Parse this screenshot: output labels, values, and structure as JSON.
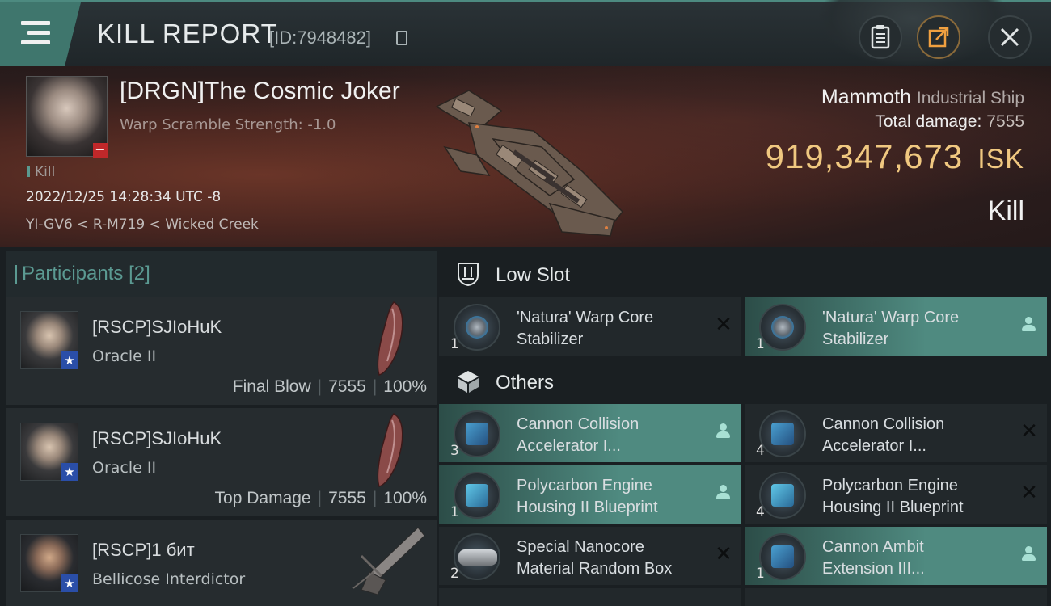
{
  "header": {
    "title": "KILL REPORT",
    "report_id": "[ID:7948482]",
    "buttons": [
      "clipboard-icon",
      "share-icon",
      "close-icon"
    ]
  },
  "victim": {
    "name": "[DRGN]The Cosmic Joker",
    "warp_scramble": "Warp Scramble Strength: -1.0",
    "status_tag": "Kill",
    "datetime": "2022/12/25 14:28:34 UTC -8",
    "location": "YI-GV6 < R-M719 < Wicked Creek",
    "ship_name": "Mammoth",
    "ship_class": "Industrial Ship",
    "total_damage_label": "Total damage:",
    "total_damage": "7555",
    "isk_value": "919,347,673",
    "isk_unit": "ISK",
    "result": "Kill"
  },
  "participants": {
    "label": "Participants",
    "count": "[2]",
    "rows": [
      {
        "name": "[RSCP]SJIoHuK",
        "ship": "Oracle II",
        "role": "Final Blow",
        "damage": "7555",
        "percent": "100%"
      },
      {
        "name": "[RSCP]SJIoHuK",
        "ship": "Oracle II",
        "role": "Top Damage",
        "damage": "7555",
        "percent": "100%"
      },
      {
        "name": "[RSCP]1 бит",
        "ship": "Bellicose Interdictor"
      }
    ]
  },
  "sections": {
    "low_slot": "Low Slot",
    "others": "Others"
  },
  "modules": {
    "low_slot": [
      {
        "qty": "1",
        "line1": "'Natura' Warp Core",
        "line2": "Stabilizer",
        "status": "destroyed"
      },
      {
        "qty": "1",
        "line1": "'Natura' Warp Core",
        "line2": "Stabilizer",
        "status": "dropped"
      }
    ],
    "others": [
      {
        "qty": "3",
        "line1": "Cannon Collision",
        "line2": "Accelerator I...",
        "status": "dropped"
      },
      {
        "qty": "4",
        "line1": "Cannon Collision",
        "line2": "Accelerator I...",
        "status": "destroyed"
      },
      {
        "qty": "1",
        "line1": "Polycarbon Engine",
        "line2": "Housing II Blueprint",
        "status": "dropped"
      },
      {
        "qty": "4",
        "line1": "Polycarbon Engine",
        "line2": "Housing II Blueprint",
        "status": "destroyed"
      },
      {
        "qty": "2",
        "line1": "Special Nanocore",
        "line2": "Material Random Box",
        "status": "destroyed"
      },
      {
        "qty": "1",
        "line1": "Cannon Ambit",
        "line2": "Extension III...",
        "status": "dropped"
      }
    ]
  },
  "colors": {
    "accent": "#4f8a80",
    "isk": "#f0c880",
    "destroyed_badge": "#c0282a",
    "star_badge": "#2a4ea8"
  }
}
